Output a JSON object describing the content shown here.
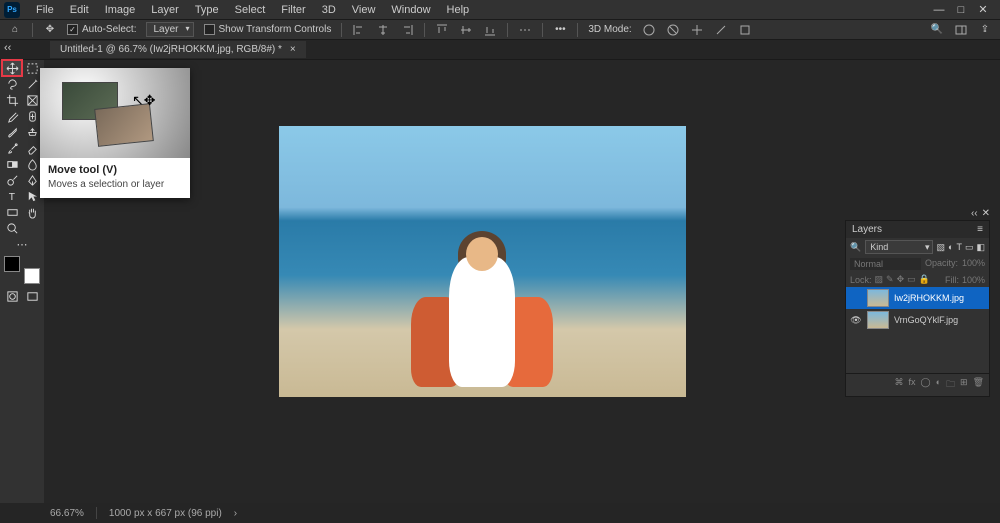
{
  "app": {
    "logo_text": "Ps"
  },
  "menu": {
    "items": [
      "File",
      "Edit",
      "Image",
      "Layer",
      "Type",
      "Select",
      "Filter",
      "3D",
      "View",
      "Window",
      "Help"
    ]
  },
  "options": {
    "auto_select_label": "Auto-Select:",
    "auto_select_checked": "✓",
    "target_select": "Layer",
    "show_transform_label": "Show Transform Controls",
    "mode_3d_label": "3D Mode:"
  },
  "tab": {
    "title": "Untitled-1 @ 66.7% (Iw2jRHOKKM.jpg, RGB/8#) *",
    "close": "×"
  },
  "tools": {
    "list": [
      "move",
      "marquee",
      "lasso",
      "wand",
      "crop",
      "frame",
      "eyedropper",
      "heal",
      "brush",
      "stamp",
      "history",
      "eraser",
      "gradient",
      "blur",
      "dodge",
      "pen",
      "type",
      "path",
      "rectangle",
      "hand",
      "zoom",
      "edit-toolbar"
    ]
  },
  "tooltip": {
    "title": "Move tool (V)",
    "desc": "Moves a selection or layer"
  },
  "layers_panel": {
    "title": "Layers",
    "filter_kind": "Kind",
    "blend_mode": "Normal",
    "opacity_label": "Opacity:",
    "opacity_value": "100%",
    "lock_label": "Lock:",
    "fill_label": "Fill:",
    "fill_value": "100%",
    "items": [
      {
        "name": "Iw2jRHOKKM.jpg",
        "visible": ""
      },
      {
        "name": "VrnGoQYklF.jpg",
        "visible": "👁"
      }
    ],
    "search_icon_label": "🔍"
  },
  "status": {
    "zoom": "66.67%",
    "doc_size": "1000 px x 667 px (96 ppi)",
    "arrow": "›"
  },
  "icons": {
    "home": "⌂",
    "move_arrows": "✥",
    "dots": "•••",
    "minimize": "—",
    "maximize": "□",
    "close": "✕",
    "chevrons": "‹‹",
    "search": "🔍",
    "share": "⇪"
  }
}
